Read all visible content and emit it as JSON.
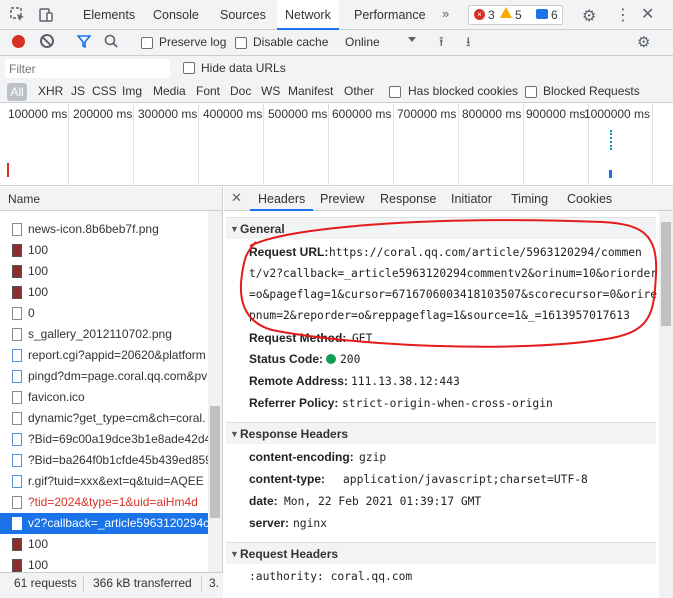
{
  "main_tabs": [
    "Elements",
    "Console",
    "Sources",
    "Network",
    "Performance"
  ],
  "badges": {
    "errors": "3",
    "warnings": "5",
    "messages": "6"
  },
  "toolbar": {
    "preserve_log": "Preserve log",
    "disable_cache": "Disable cache",
    "throttle": "Online"
  },
  "filter": {
    "placeholder": "Filter",
    "hide_data_urls": "Hide data URLs"
  },
  "types": [
    "All",
    "XHR",
    "JS",
    "CSS",
    "Img",
    "Media",
    "Font",
    "Doc",
    "WS",
    "Manifest",
    "Other"
  ],
  "type_checks": {
    "blocked_cookies": "Has blocked cookies",
    "blocked_requests": "Blocked Requests"
  },
  "timeline_ticks": [
    "100000 ms",
    "200000 ms",
    "300000 ms",
    "400000 ms",
    "500000 ms",
    "600000 ms",
    "700000 ms",
    "800000 ms",
    "900000 ms",
    "1000000 ms"
  ],
  "requests": {
    "header": "Name",
    "rows": [
      {
        "name": "news-icon.8b6beb7f.png",
        "kind": "file",
        "style": ""
      },
      {
        "name": "100",
        "kind": "img",
        "style": ""
      },
      {
        "name": "100",
        "kind": "img",
        "style": ""
      },
      {
        "name": "100",
        "kind": "img",
        "style": ""
      },
      {
        "name": "0",
        "kind": "file",
        "style": ""
      },
      {
        "name": "s_gallery_2012110702.png",
        "kind": "file",
        "style": ""
      },
      {
        "name": "report.cgi?appid=20620&platform",
        "kind": "doc",
        "style": ""
      },
      {
        "name": "pingd?dm=page.coral.qq.com&pv",
        "kind": "doc",
        "style": ""
      },
      {
        "name": "favicon.ico",
        "kind": "file",
        "style": ""
      },
      {
        "name": "dynamic?get_type=cm&ch=coral.",
        "kind": "file",
        "style": ""
      },
      {
        "name": "?Bid=69c00a19dce3b1e8ade42d4",
        "kind": "doc",
        "style": ""
      },
      {
        "name": "?Bid=ba264f0b1cfde45b439ed859",
        "kind": "doc",
        "style": ""
      },
      {
        "name": "r.gif?tuid=xxx&ext=q&tuid=AQEE",
        "kind": "doc",
        "style": ""
      },
      {
        "name": "?tid=2024&type=1&uid=aiHm4d",
        "kind": "file",
        "style": "red"
      },
      {
        "name": "v2?callback=_article5963120294cc",
        "kind": "doc",
        "style": "sel"
      },
      {
        "name": "100",
        "kind": "img",
        "style": ""
      },
      {
        "name": "100",
        "kind": "img",
        "style": ""
      }
    ]
  },
  "status": {
    "requests": "61 requests",
    "transferred": "366 kB transferred",
    "extra": "3."
  },
  "detail_tabs": [
    "Headers",
    "Preview",
    "Response",
    "Initiator",
    "Timing",
    "Cookies"
  ],
  "general": {
    "title": "General",
    "request_url_label": "Request URL:",
    "request_url_lines": [
      "https://coral.qq.com/article/5963120294/commen",
      "t/v2?callback=_article5963120294commentv2&orinum=10&oriorder",
      "=o&pageflag=1&cursor=6716706003418103507&scorecursor=0&orire",
      "pnum=2&reporder=o&reppageflag=1&source=1&_=1613957017613"
    ],
    "method_label": "Request Method:",
    "method": "GET",
    "status_label": "Status Code:",
    "status": "200",
    "status_color": "#0f9d58",
    "remote_label": "Remote Address:",
    "remote": "111.13.38.12:443",
    "referrer_label": "Referrer Policy:",
    "referrer": "strict-origin-when-cross-origin"
  },
  "response_headers": {
    "title": "Response Headers",
    "items": [
      {
        "k": "content-encoding:",
        "v": "gzip"
      },
      {
        "k": "content-type:",
        "v": "application/javascript;charset=UTF-8"
      },
      {
        "k": "date:",
        "v": "Mon, 22 Feb 2021 01:39:17 GMT"
      },
      {
        "k": "server:",
        "v": "nginx"
      }
    ]
  },
  "request_headers": {
    "title": "Request Headers",
    "first": ":authority: coral.qq.com"
  },
  "colors": {
    "accent": "#1a73e8",
    "annotation": "#e31b1b",
    "record": "#d93025"
  }
}
